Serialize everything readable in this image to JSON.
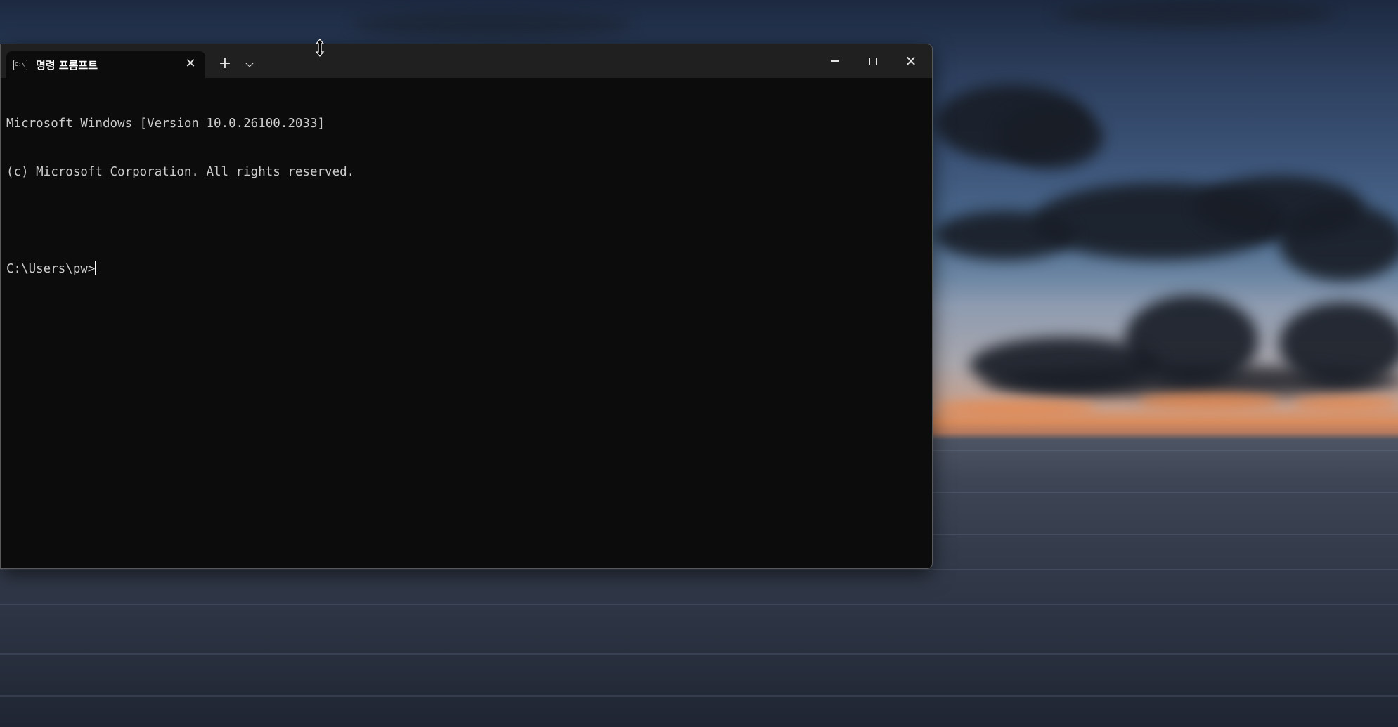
{
  "terminal": {
    "tab_title": "명령 프롬프트",
    "tab_icon_text": "C:\\",
    "tab_close_glyph": "✕",
    "new_tab_glyph": "+",
    "window_buttons": {
      "minimize": "minimize-icon",
      "maximize": "maximize-icon",
      "close_glyph": "✕"
    },
    "lines": [
      "Microsoft Windows [Version 10.0.26100.2033]",
      "(c) Microsoft Corporation. All rights reserved.",
      "",
      "C:\\Users\\pw>"
    ]
  },
  "mouse_cursor": "vertical-resize-cursor-icon"
}
